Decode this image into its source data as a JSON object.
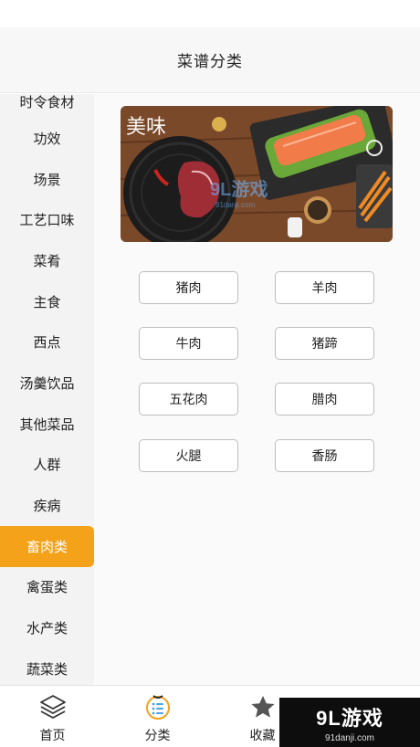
{
  "header": {
    "title": "菜谱分类"
  },
  "sidebar": {
    "items": [
      {
        "label": "时令食材"
      },
      {
        "label": "功效"
      },
      {
        "label": "场景"
      },
      {
        "label": "工艺口味"
      },
      {
        "label": "菜肴"
      },
      {
        "label": "主食"
      },
      {
        "label": "西点"
      },
      {
        "label": "汤羹饮品"
      },
      {
        "label": "其他菜品"
      },
      {
        "label": "人群"
      },
      {
        "label": "疾病"
      },
      {
        "label": "畜肉类"
      },
      {
        "label": "禽蛋类"
      },
      {
        "label": "水产类"
      },
      {
        "label": "蔬菜类"
      }
    ],
    "active_label": "畜肉类"
  },
  "main": {
    "banner": {
      "overlay_text": "美味",
      "watermark_text": "9L游戏",
      "watermark_url": "91danji.com"
    },
    "tags": [
      {
        "label": "猪肉"
      },
      {
        "label": "羊肉"
      },
      {
        "label": "牛肉"
      },
      {
        "label": "猪蹄"
      },
      {
        "label": "五花肉"
      },
      {
        "label": "腊肉"
      },
      {
        "label": "火腿"
      },
      {
        "label": "香肠"
      }
    ]
  },
  "tabbar": {
    "tabs": [
      {
        "label": "首页",
        "icon": "layers-icon"
      },
      {
        "label": "分类",
        "icon": "category-icon"
      },
      {
        "label": "收藏",
        "icon": "star-icon"
      }
    ]
  },
  "watermark": {
    "logo": "9L游戏",
    "url": "91danji.com"
  },
  "colors": {
    "accent": "#f4a21a",
    "sidebar_bg": "#f3f3f3"
  }
}
